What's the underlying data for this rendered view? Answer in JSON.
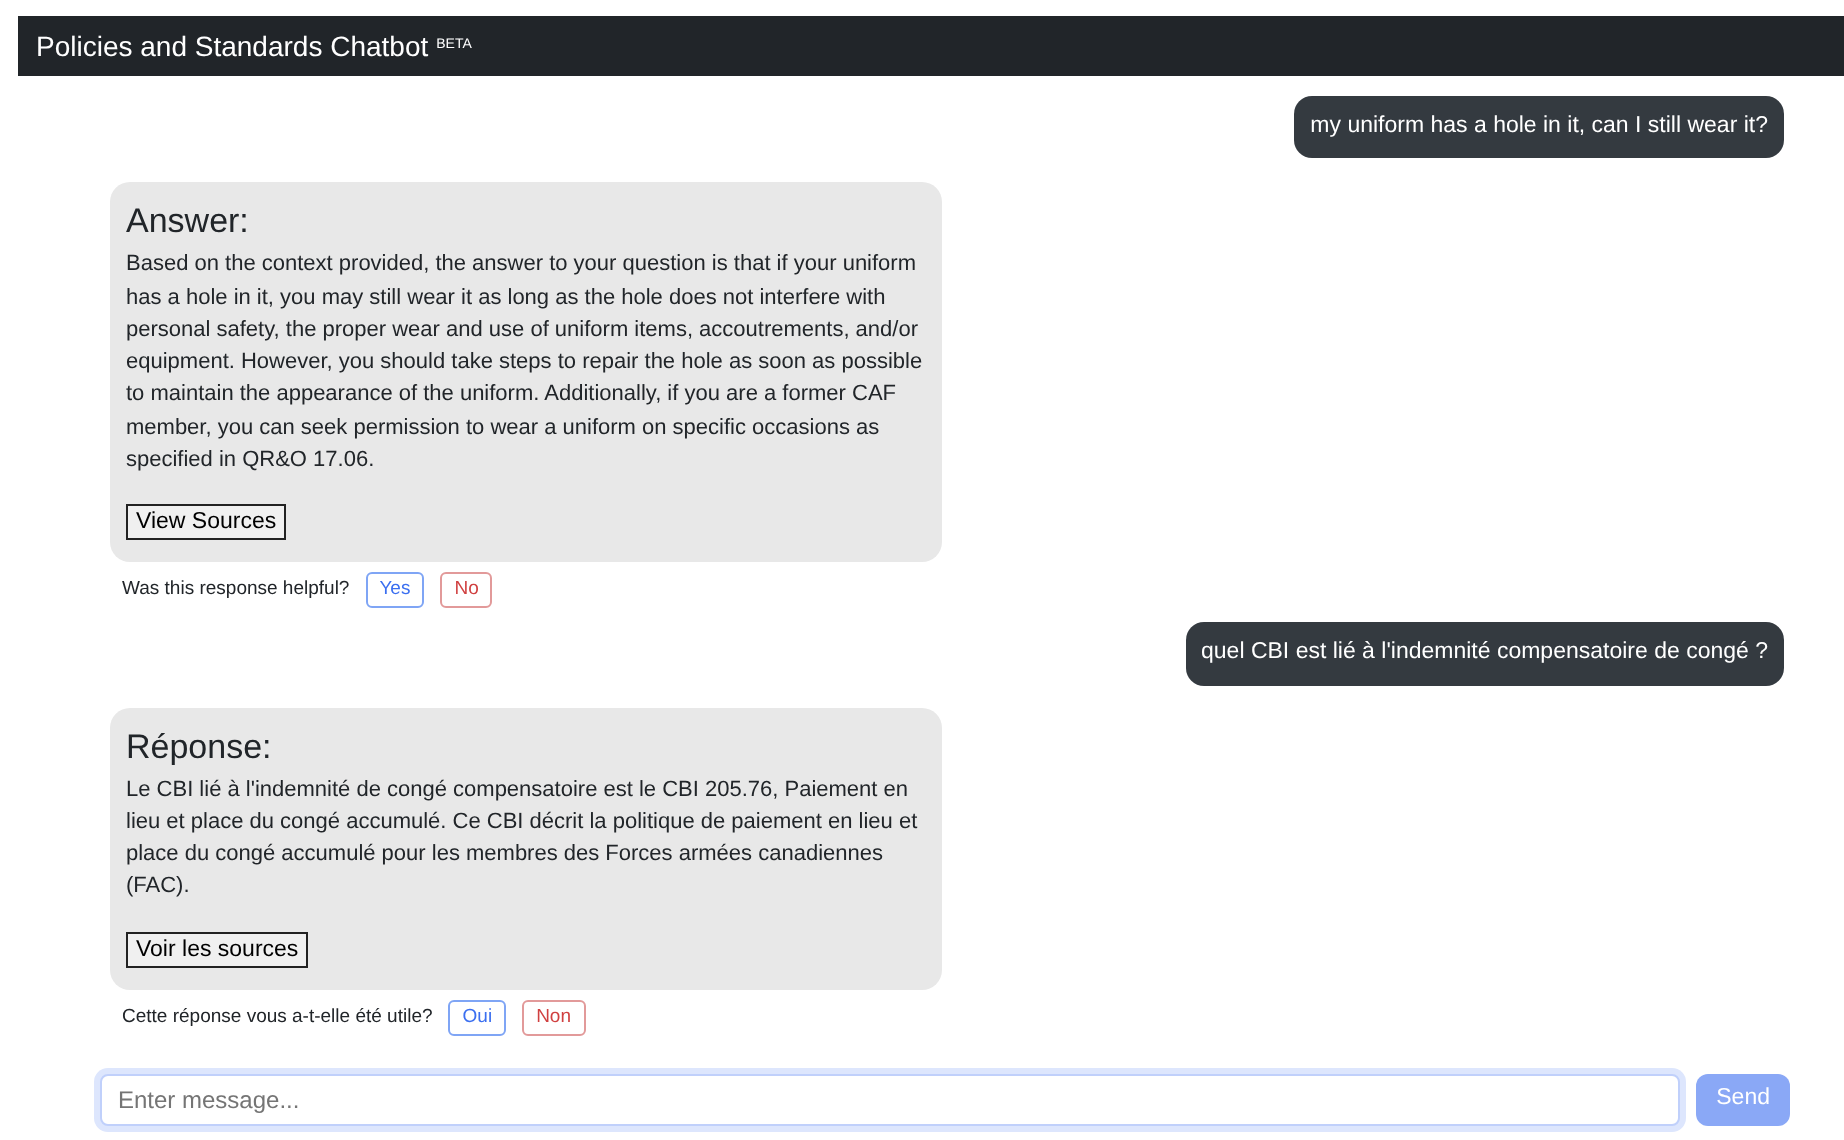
{
  "navbar": {
    "title": "Policies and Standards Chatbot",
    "badge": "BETA"
  },
  "messages": [
    {
      "kind": "user",
      "text": "my uniform has a hole in it, can I still wear it?"
    },
    {
      "kind": "bot",
      "heading": "Answer:",
      "text": "Based on the context provided, the answer to your question is that if your uniform has a hole in it, you may still wear it as long as the hole does not interfere with personal safety, the proper wear and use of uniform items, accoutrements, and/or equipment. However, you should take steps to repair the hole as soon as possible to maintain the appearance of the uniform. Additionally, if you are a former CAF member, you can seek permission to wear a uniform on specific occasions as specified in QR&O 17.06.",
      "sources_button": "View Sources",
      "feedback": {
        "question": "Was this response helpful?",
        "yes": "Yes",
        "no": "No"
      }
    },
    {
      "kind": "user",
      "text": "quel CBI est lié à l'indemnité compensatoire de congé ?"
    },
    {
      "kind": "bot",
      "heading": "Réponse:",
      "text": "Le CBI lié à l'indemnité de congé compensatoire est le CBI 205.76, Paiement en lieu et place du congé accumulé. Ce CBI décrit la politique de paiement en lieu et place du congé accumulé pour les membres des Forces armées canadiennes (FAC).",
      "sources_button": "Voir les sources",
      "feedback": {
        "question": "Cette réponse vous a-t-elle été utile?",
        "yes": "Oui",
        "no": "Non"
      }
    }
  ],
  "composer": {
    "placeholder": "Enter message...",
    "focused": true,
    "send_button": {
      "label": "Send",
      "disabled": true
    }
  }
}
